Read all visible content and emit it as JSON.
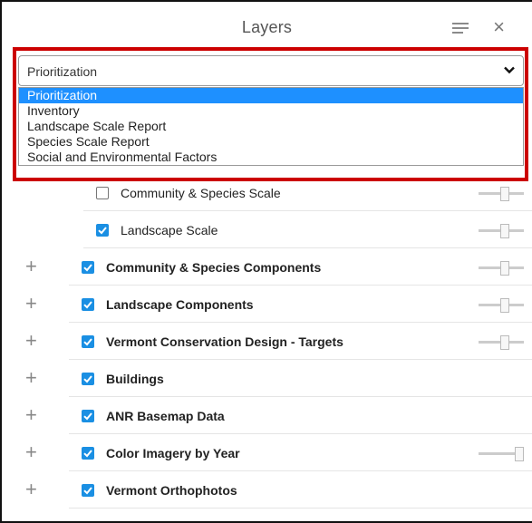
{
  "header": {
    "title": "Layers"
  },
  "select": {
    "value": "Prioritization",
    "options": [
      "Prioritization",
      "Inventory",
      "Landscape Scale Report",
      "Species Scale Report",
      "Social and Environmental Factors"
    ],
    "selected_index": 0
  },
  "layers": [
    {
      "label": "Community & Species Scale",
      "checked": false,
      "sublayer": true,
      "slider": true,
      "slider_level": 0.6
    },
    {
      "label": "Landscape Scale",
      "checked": true,
      "sublayer": true,
      "slider": true,
      "slider_level": 0.6
    },
    {
      "label": "Community & Species Components",
      "checked": true,
      "sublayer": false,
      "slider": true,
      "slider_level": 0.6
    },
    {
      "label": "Landscape Components",
      "checked": true,
      "sublayer": false,
      "slider": true,
      "slider_level": 0.6
    },
    {
      "label": "Vermont Conservation Design - Targets",
      "checked": true,
      "sublayer": false,
      "slider": true,
      "slider_level": 0.6
    },
    {
      "label": "Buildings",
      "checked": true,
      "sublayer": false,
      "slider": false
    },
    {
      "label": "ANR Basemap Data",
      "checked": true,
      "sublayer": false,
      "slider": false
    },
    {
      "label": "Color Imagery by Year",
      "checked": true,
      "sublayer": false,
      "slider": true,
      "slider_level": 1.0
    },
    {
      "label": "Vermont Orthophotos",
      "checked": true,
      "sublayer": false,
      "slider": false
    }
  ],
  "colors": {
    "accent": "#1a8fe3",
    "highlight": "#cc0000",
    "option_selected": "#1e90ff"
  },
  "icons": {
    "expand": "plus-icon",
    "menu": "menu-icon",
    "close": "close-icon",
    "dropdown": "chevron-down-icon"
  }
}
